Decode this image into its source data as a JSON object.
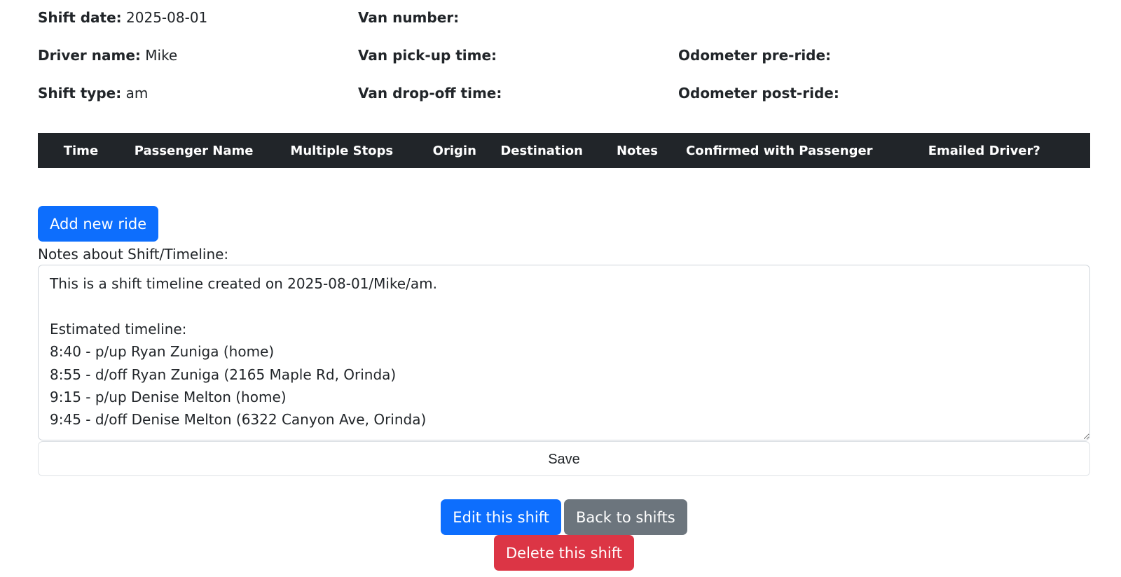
{
  "shift": {
    "date_label": "Shift date:",
    "date_value": "2025-08-01",
    "driver_label": "Driver name:",
    "driver_value": "Mike",
    "type_label": "Shift type:",
    "type_value": "am",
    "van_number_label": "Van number:",
    "van_pickup_label": "Van pick-up time:",
    "van_dropoff_label": "Van drop-off time:",
    "odometer_pre_label": "Odometer pre-ride:",
    "odometer_post_label": "Odometer post-ride:"
  },
  "rides_table": {
    "headers": [
      "Time",
      "Passenger Name",
      "Multiple Stops",
      "Origin",
      "Destination",
      "Notes",
      "Confirmed with Passenger",
      "Emailed Driver?"
    ]
  },
  "buttons": {
    "add_ride": "Add new ride",
    "save": "Save",
    "edit_shift": "Edit this shift",
    "back_to_shifts": "Back to shifts",
    "delete_shift": "Delete this shift"
  },
  "notes": {
    "label": "Notes about Shift/Timeline:",
    "value": "This is a shift timeline created on 2025-08-01/Mike/am.\n\nEstimated timeline:\n8:40 - p/up Ryan Zuniga (home)\n8:55 - d/off Ryan Zuniga (2165 Maple Rd, Orinda)\n9:15 - p/up Denise Melton (home)\n9:45 - d/off Denise Melton (6322 Canyon Ave, Orinda)"
  },
  "colors": {
    "primary": "#0d6efd",
    "secondary": "#6c757d",
    "danger": "#dc3545",
    "table_header": "#212529"
  }
}
